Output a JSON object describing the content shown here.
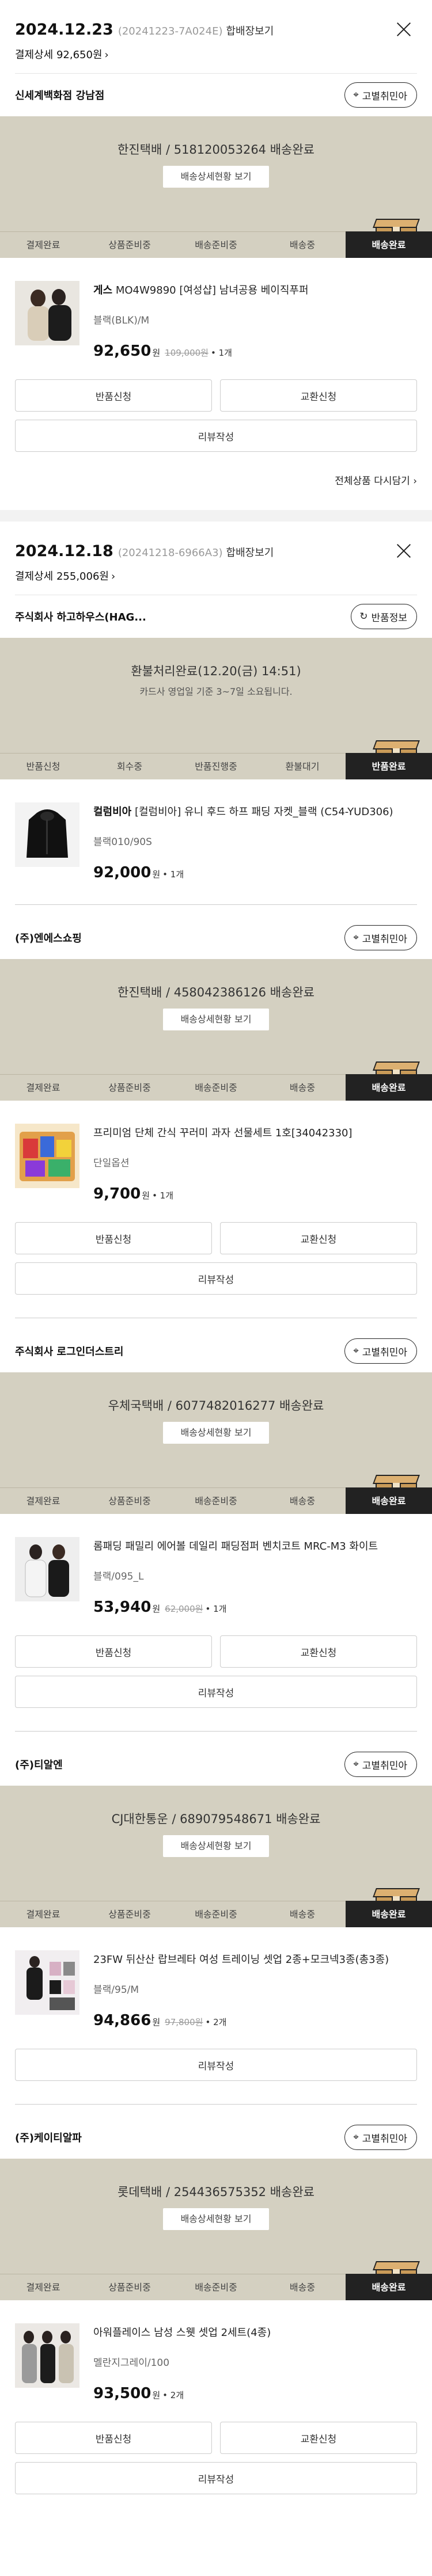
{
  "orders": [
    {
      "date": "2024.12.23",
      "order_id": "(20241223-7A024E)",
      "bundle": "합배장보기",
      "payment": "결제상세 92,650원",
      "pay_chev": "›",
      "shops": [
        {
          "name": "신세계백화점 강남점",
          "pill": "고별취민아",
          "pill_icon": "pin-icon",
          "banner": {
            "line1": "한진택배 / 518120053264 배송완료",
            "button": "배송상세현황 보기"
          },
          "steps": [
            "결제완료",
            "상품준비중",
            "배송준비중",
            "배송중",
            "배송완료"
          ],
          "active": 4,
          "item": {
            "brand": "게스",
            "name": " MO4W9890 [여성샵] 남녀공용 베이직푸퍼",
            "option": "블랙(BLK)/M",
            "price": "92,650",
            "won": "원",
            "orig": "109,000원",
            "qty": "• 1개"
          },
          "btns": [
            "반품신청",
            "교환신청"
          ],
          "full": "리뷰작성"
        }
      ],
      "readd": "전체상품 다시담기 ›"
    },
    {
      "date": "2024.12.18",
      "order_id": "(20241218-6966A3)",
      "bundle": "합배장보기",
      "payment": "결제상세 255,006원",
      "pay_chev": "›",
      "shops": [
        {
          "name": "주식회사 하고하우스(HAG...",
          "pill": "반품정보",
          "pill_icon": "refresh-icon",
          "banner": {
            "line1": "환불처리완료(12.20(금) 14:51)",
            "line2": "카드사 영업일 기준 3~7일 소요됩니다."
          },
          "steps": [
            "반품신청",
            "회수중",
            "반품진행중",
            "환불대기",
            "반품완료"
          ],
          "active": 4,
          "item": {
            "brand": "컬럼비아",
            "name": " [컬럼비아] 유니 후드 하프 패딩 자켓_블랙 (C54-YUD306)",
            "option": "블랙010/90S",
            "price": "92,000",
            "won": "원",
            "orig": "",
            "qty": "• 1개"
          }
        },
        {
          "name": "(주)엔에스쇼핑",
          "pill": "고별취민아",
          "pill_icon": "pin-icon",
          "banner": {
            "line1": "한진택배 / 458042386126 배송완료",
            "button": "배송상세현황 보기"
          },
          "steps": [
            "결제완료",
            "상품준비중",
            "배송준비중",
            "배송중",
            "배송완료"
          ],
          "active": 4,
          "item": {
            "brand": "",
            "name": "프리미엄 단체 간식 꾸러미 과자 선물세트 1호[34042330]",
            "option": "단일옵션",
            "price": "9,700",
            "won": "원",
            "orig": "",
            "qty": "• 1개"
          },
          "btns": [
            "반품신청",
            "교환신청"
          ],
          "full": "리뷰작성"
        },
        {
          "name": "주식회사 로그인더스트리",
          "pill": "고별취민아",
          "pill_icon": "pin-icon",
          "banner": {
            "line1": "우체국택배 / 6077482016277 배송완료",
            "button": "배송상세현황 보기"
          },
          "steps": [
            "결제완료",
            "상품준비중",
            "배송준비중",
            "배송중",
            "배송완료"
          ],
          "active": 4,
          "item": {
            "brand": "",
            "name": "롬패딩 패밀리 에어볼 데일리 패딩점퍼 벤치코트 MRC-M3 화이트",
            "option": "블랙/095_L",
            "price": "53,940",
            "won": "원",
            "orig": "62,000원",
            "qty": "• 1개"
          },
          "btns": [
            "반품신청",
            "교환신청"
          ],
          "full": "리뷰작성"
        },
        {
          "name": "(주)티알엔",
          "pill": "고별취민아",
          "pill_icon": "pin-icon",
          "banner": {
            "line1": "CJ대한통운 / 689079548671 배송완료",
            "button": "배송상세현황 보기"
          },
          "steps": [
            "결제완료",
            "상품준비중",
            "배송준비중",
            "배송중",
            "배송완료"
          ],
          "active": 4,
          "item": {
            "brand": "",
            "name": "23FW 뒤산산 랍브레타 여성 트레이닝 셋업 2종+모크넥3종(총3종)",
            "option": "블랙/95/M",
            "price": "94,866",
            "won": "원",
            "orig": "97,800원",
            "qty": "• 2개"
          },
          "full": "리뷰작성"
        },
        {
          "name": "(주)케이티알파",
          "pill": "고별취민아",
          "pill_icon": "pin-icon",
          "banner": {
            "line1": "롯데택배 / 254436575352 배송완료",
            "button": "배송상세현황 보기"
          },
          "steps": [
            "결제완료",
            "상품준비중",
            "배송준비중",
            "배송중",
            "배송완료"
          ],
          "active": 4,
          "item": {
            "brand": "",
            "name": "아워플레이스 남성 스웻 셋업 2세트(4종)",
            "option": "멜란지그레이/100",
            "price": "93,500",
            "won": "원",
            "orig": "",
            "qty": "• 2개"
          },
          "btns": [
            "반품신청",
            "교환신청"
          ],
          "full": "리뷰작성"
        }
      ]
    }
  ]
}
